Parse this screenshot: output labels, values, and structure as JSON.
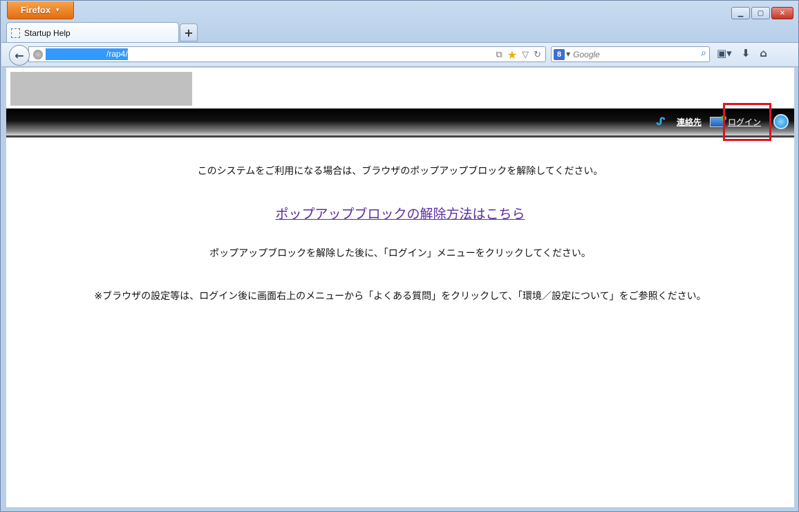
{
  "browser": {
    "menu_button": "Firefox",
    "tab_title": "Startup Help",
    "new_tab_label": "+",
    "url": "/rap4/",
    "search_engine_icon": "8",
    "search_placeholder": "Google"
  },
  "page": {
    "menu": {
      "contact_label": "連絡先",
      "login_label": "ログイン"
    },
    "message_1": "このシステムをご利用になる場合は、ブラウザのポップアップブロックを解除してください。",
    "link_text": "ポップアップブロックの解除方法はこちら",
    "message_2": "ポップアップブロックを解除した後に、「ログイン」メニューをクリックしてください。",
    "message_3": "※ブラウザの設定等は、ログイン後に画面右上のメニューから「よくある質問」をクリックして、「環境／設定について」をご参照ください。"
  },
  "colors": {
    "highlight": "#e0131f",
    "link": "#5a2ca0",
    "firefox_orange": "#e46d12"
  }
}
